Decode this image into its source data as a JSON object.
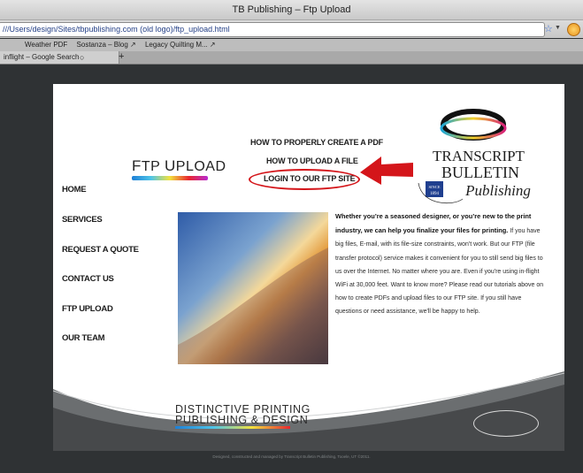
{
  "window": {
    "title": "TB Publishing – Ftp Upload"
  },
  "address_bar": {
    "url": "///Users/design/Sites/tbpublishing.com (old logo)/ftp_upload.html"
  },
  "bookmarks": [
    "Weather PDF",
    "Sostanza – Blog ↗",
    "Legacy Quilting M... ↗"
  ],
  "tabs": [
    {
      "label": "inflight – Google Search"
    }
  ],
  "site": {
    "page_links": [
      "HOW TO PROPERLY CREATE A PDF",
      "HOW TO UPLOAD A FILE",
      "LOGIN TO OUR FTP SITE"
    ],
    "page_title": {
      "first": "F",
      "rest1": "TP ",
      "second": "U",
      "rest2": "PLOAD"
    },
    "logo": {
      "line1": "TRANSCRIPT",
      "line2": "BULLETIN",
      "since": "SINCE",
      "year": "1894",
      "script": "Publishing"
    },
    "side_nav": [
      "HOME",
      "SERVICES",
      "REQUEST A QUOTE",
      "CONTACT US",
      "FTP UPLOAD",
      "OUR TEAM"
    ],
    "body": {
      "lead": "Whether you’re a seasoned designer, or you’re new to the print industry, we can help you finalize your files for printing.",
      "rest": " If you have big files, E-mail, with its file-size constraints, won't work. But our FTP (file transfer protocol) service makes it convenient for you to still send big files to us over the Internet. No matter where you are. Even if you're using in-flight WiFi at 30,000 feet. Want to know more? Please read our tutorials above on how to create PDFs and upload files to our FTP site. If you still have questions or need assistance, we'll be happy to help."
    },
    "tagline": {
      "line1": "DISTINCTIVE PRINTING",
      "line2": "PUBLISHING & DESIGN"
    },
    "copyright": "Designed, constructed and managed by Transcript Bulletin Publishing, Tooele, UT ©2011."
  },
  "colors": {
    "accent_red": "#d4151a",
    "page_bg": "#2f3234"
  },
  "icons": [
    "bookmark-star-icon",
    "dropdown-icon",
    "extension-icon",
    "tab-close-icon",
    "new-tab-icon",
    "red-arrow-icon"
  ]
}
